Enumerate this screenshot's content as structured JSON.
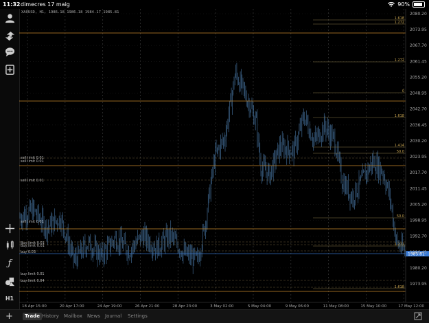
{
  "status": {
    "time": "11:32",
    "date": "dimecres 17 maig",
    "battery": "90%"
  },
  "chart": {
    "title": "XAUUSD, H1, 1986.18 1986.18 1984.17 1985.81",
    "price_labels": [
      "2080.20",
      "2073.95",
      "2067.70",
      "2061.45",
      "2055.20",
      "2048.95",
      "2042.70",
      "2036.45",
      "2030.20",
      "2023.95",
      "2017.70",
      "2011.45",
      "2005.20",
      "1998.95",
      "1992.70",
      "1986.45",
      "1980.20",
      "1973.95"
    ],
    "date_labels": [
      "18 Apr 15:00",
      "20 Apr 17:00",
      "24 Apr 19:00",
      "26 Apr 21:00",
      "28 Apr 23:00",
      "3 May 02:00",
      "5 May 04:00",
      "9 May 06:00",
      "11 May 08:00",
      "15 May 10:00",
      "17 May 12:00"
    ],
    "fib_labels": [
      "1.618",
      "1.272",
      "1.272",
      "0",
      "1.618",
      "1.414",
      "50.0",
      "50.0",
      "1.272",
      "1.618"
    ],
    "current_price": "1985.81",
    "orders": [
      "sell limit 0.01",
      "sell limit 0.01",
      "sell limit 0.01",
      "sell limit 0.01",
      "Buy limit 0.01",
      "Buy limit 0.01",
      "buy 0.03",
      "buy limit 0.01",
      "buy limit 0.04"
    ],
    "colors": {
      "candle": "#4a7aa8",
      "grid": "#333333",
      "order_line": "#c8892a",
      "fib_line": "#8a7a4a",
      "current": "#3a7bd5"
    }
  },
  "tabs": [
    "Trade",
    "History",
    "Mailbox",
    "News",
    "Journal",
    "Settings"
  ],
  "sidebar_label": "H1"
}
